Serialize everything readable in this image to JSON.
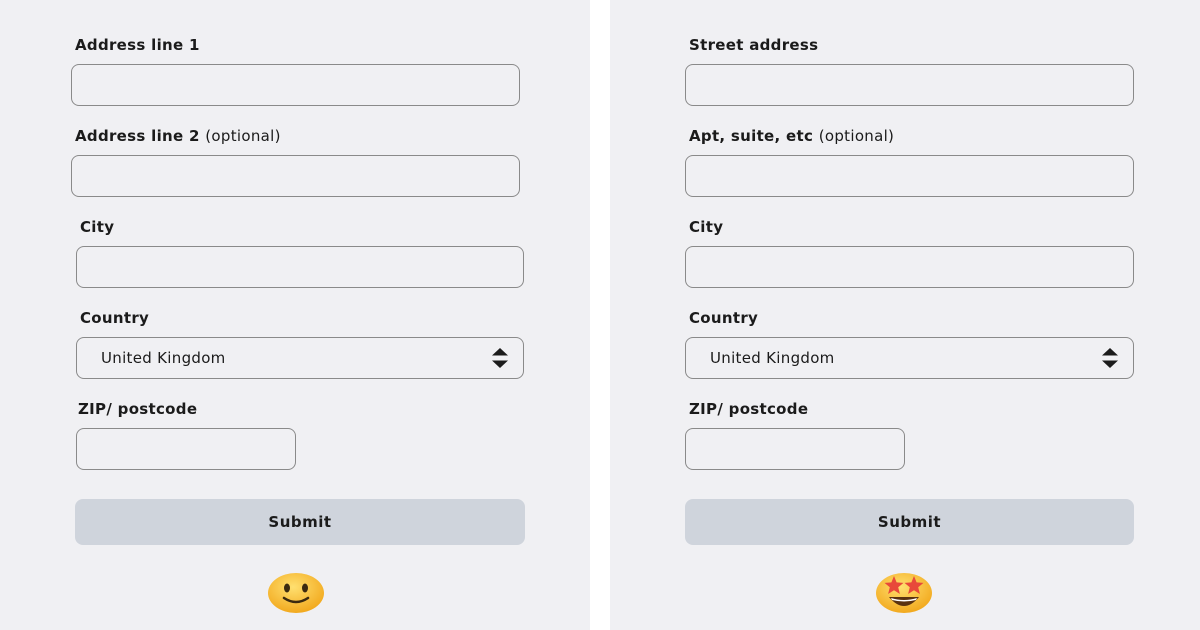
{
  "left_form": {
    "address1_label": "Address line 1",
    "address2_label": "Address line 2",
    "address2_optional": "(optional)",
    "city_label": "City",
    "country_label": "Country",
    "country_value": "United Kingdom",
    "zip_label": "ZIP/ postcode",
    "submit_label": "Submit",
    "emoji": "slightly-smiling-face"
  },
  "right_form": {
    "address1_label": "Street address",
    "address2_label": "Apt, suite, etc",
    "address2_optional": "(optional)",
    "city_label": "City",
    "country_label": "Country",
    "country_value": "United Kingdom",
    "zip_label": "ZIP/ postcode",
    "submit_label": "Submit",
    "emoji": "star-struck-face"
  },
  "colors": {
    "panel_background": "#f0f0f3",
    "field_border": "#8a8a8a",
    "submit_background": "#cfd4dc",
    "emoji_yellow": "#f7b52c"
  }
}
